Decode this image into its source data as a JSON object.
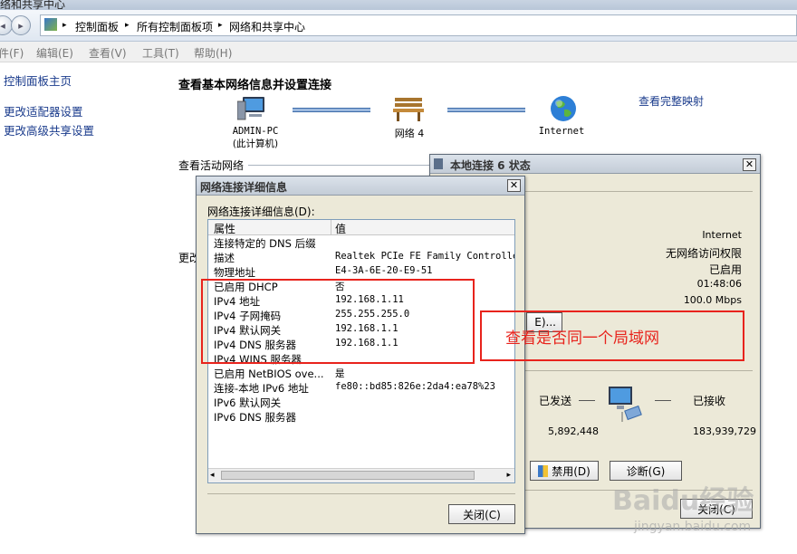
{
  "window": {
    "title": "络和共享中心"
  },
  "address": {
    "segments": [
      "控制面板",
      "所有控制面板项",
      "网络和共享中心"
    ],
    "separator": "▸"
  },
  "menu": {
    "items": [
      "件(F)",
      "编辑(E)",
      "查看(V)",
      "工具(T)",
      "帮助(H)"
    ]
  },
  "sidebar": {
    "items": [
      {
        "label": "控制面板主页"
      },
      {
        "label": "更改适配器设置"
      },
      {
        "label": "更改高级共享设置"
      }
    ]
  },
  "main": {
    "heading": "查看基本网络信息并设置连接",
    "full_map_link": "查看完整映射",
    "active_networks": "查看活动网络",
    "partial_label": "更改",
    "map": {
      "computer": "ADMIN-PC",
      "computer_sub": "(此计算机)",
      "network": "网络  4",
      "internet": "Internet"
    }
  },
  "status_dialog": {
    "title": "本地连接 6 状态",
    "values": [
      "Internet",
      "无网络访问权限",
      "已启用",
      "01:48:06",
      "100.0 Mbps"
    ],
    "details_btn_partial": "E)...",
    "sent_label": "已发送",
    "received_label": "已接收",
    "sent_value": "5,892,448",
    "received_value": "183,939,729",
    "disable_btn": "禁用(D)",
    "diagnose_btn": "诊断(G)",
    "close_btn": "关闭(C)"
  },
  "details_dialog": {
    "title": "网络连接详细信息",
    "list_label": "网络连接详细信息(D):",
    "col_property": "属性",
    "col_value": "值",
    "rows": [
      {
        "k": "连接特定的 DNS 后缀",
        "v": ""
      },
      {
        "k": "描述",
        "v": "Realtek PCIe FE Family Controller"
      },
      {
        "k": "物理地址",
        "v": "E4-3A-6E-20-E9-51"
      },
      {
        "k": "已启用 DHCP",
        "v": "否"
      },
      {
        "k": "IPv4 地址",
        "v": "192.168.1.11"
      },
      {
        "k": "IPv4 子网掩码",
        "v": "255.255.255.0"
      },
      {
        "k": "IPv4 默认网关",
        "v": "192.168.1.1"
      },
      {
        "k": "IPv4 DNS 服务器",
        "v": "192.168.1.1"
      },
      {
        "k": "IPv4 WINS 服务器",
        "v": ""
      },
      {
        "k": "已启用 NetBIOS ove...",
        "v": "是"
      },
      {
        "k": "连接-本地 IPv6 地址",
        "v": "fe80::bd85:826e:2da4:ea78%23"
      },
      {
        "k": "IPv6 默认网关",
        "v": ""
      },
      {
        "k": "IPv6 DNS 服务器",
        "v": ""
      }
    ],
    "close_btn": "关闭(C)"
  },
  "annotation": {
    "text": "查看是否同一个局域网",
    "color": "#e8231c"
  },
  "watermark": {
    "text": "Baidu经验",
    "sub": "jingyan.baidu.com"
  }
}
